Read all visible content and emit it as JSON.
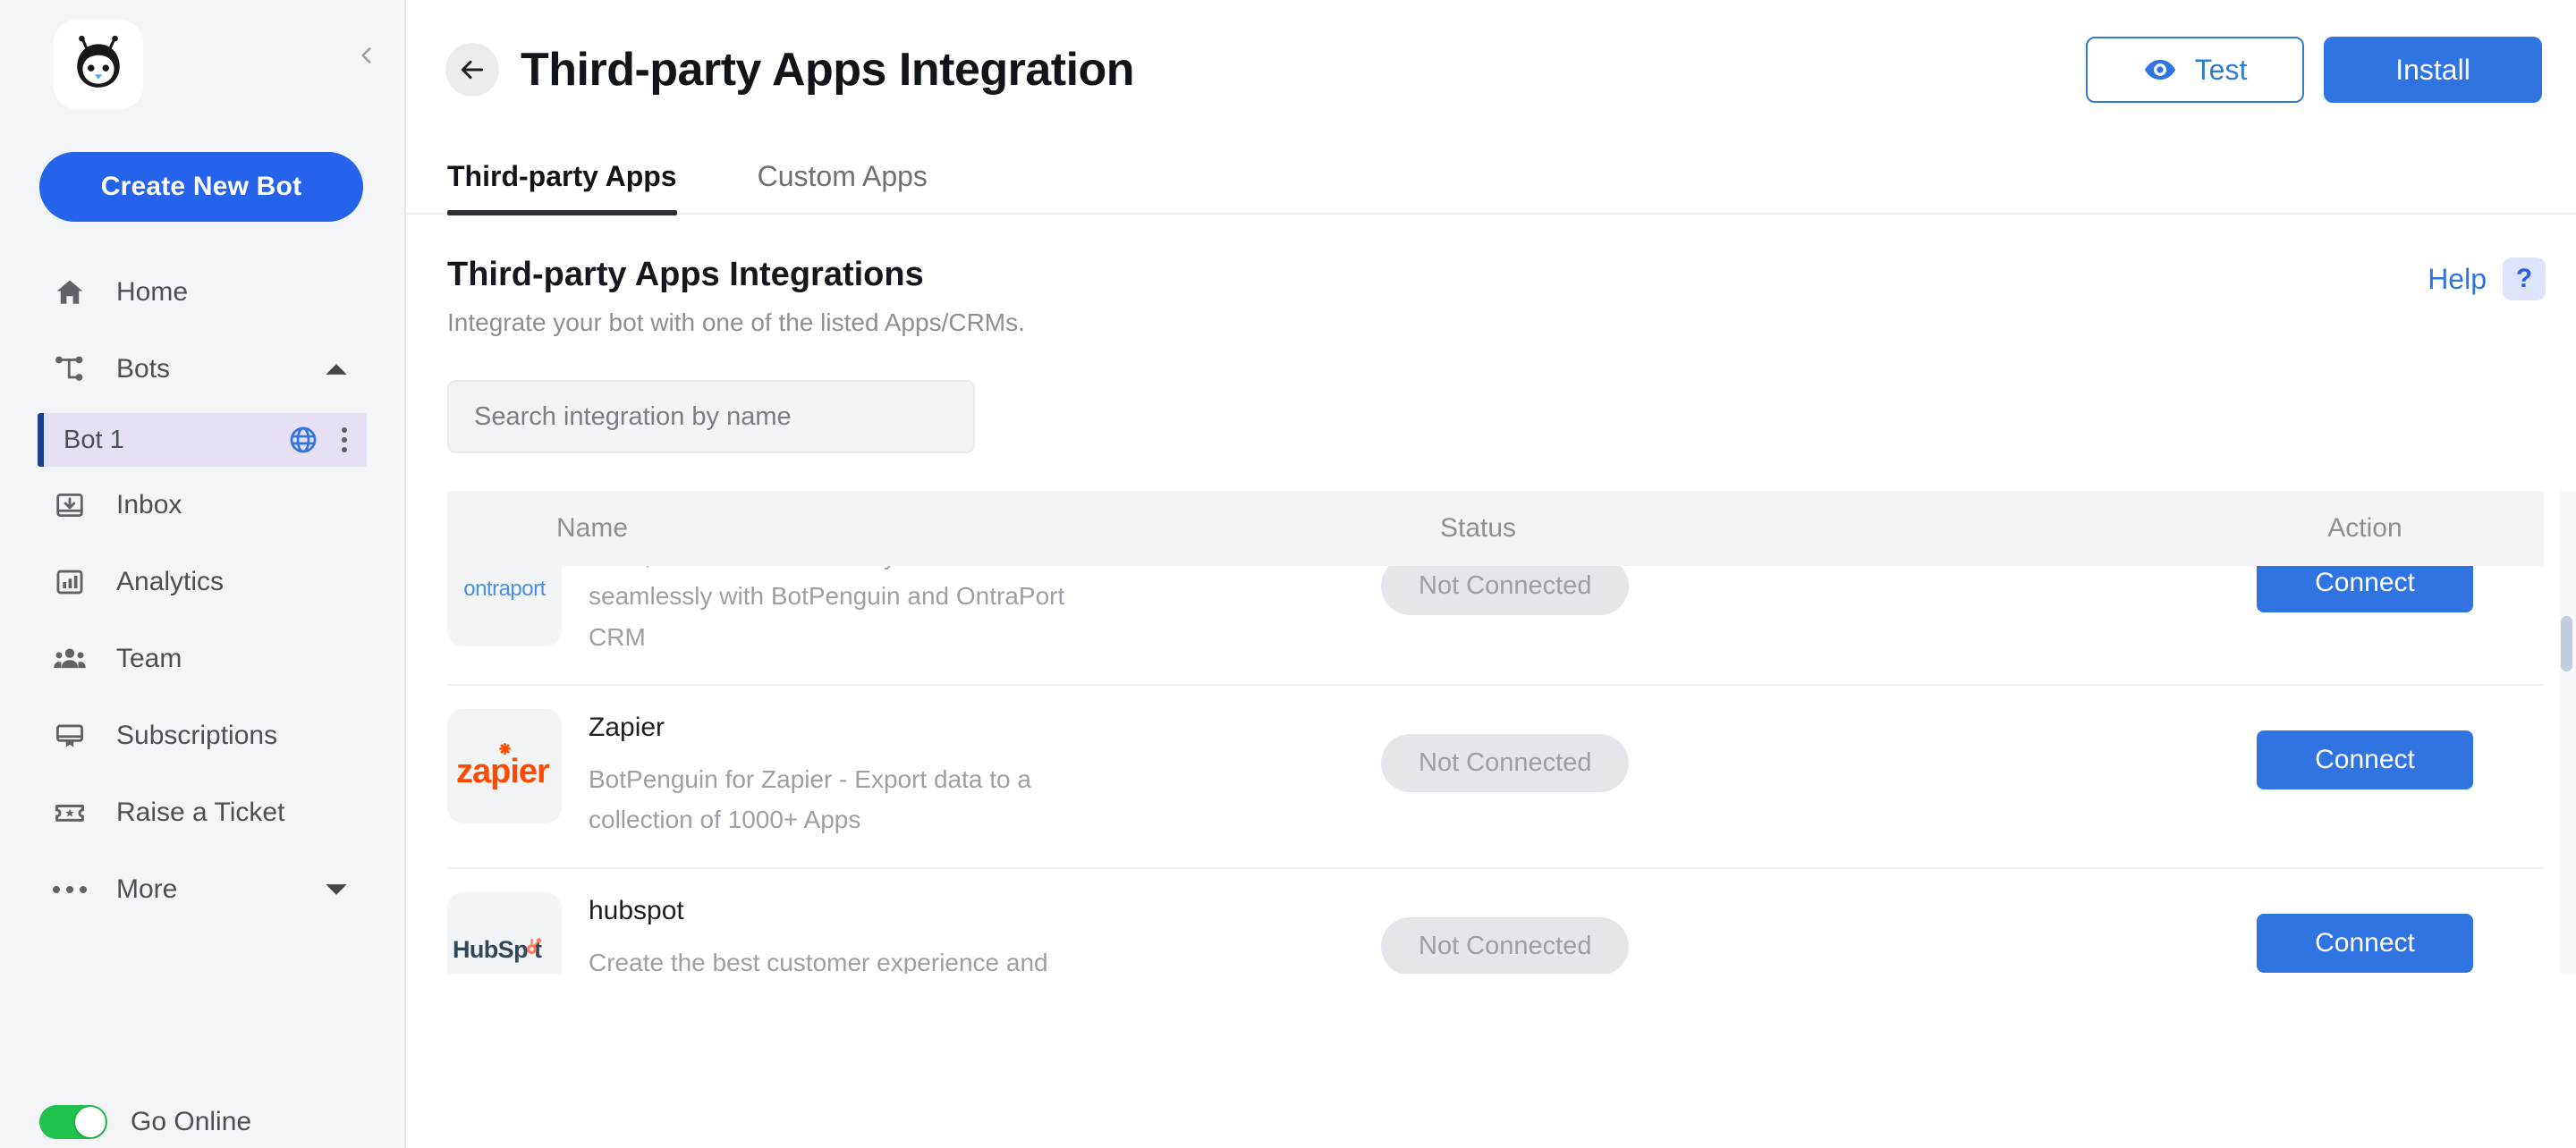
{
  "sidebar": {
    "logo_icon": "botpenguin-logo-icon",
    "collapse_icon": "chevron-left-icon",
    "create_bot_label": "Create New Bot",
    "items": [
      {
        "label": "Home",
        "icon": "home-icon",
        "caret": null
      },
      {
        "label": "Bots",
        "icon": "bots-hierarchy-icon",
        "caret": "chevron-up-icon"
      },
      {
        "label": "Inbox",
        "icon": "inbox-icon",
        "caret": null
      },
      {
        "label": "Analytics",
        "icon": "analytics-bar-chart-icon",
        "caret": null
      },
      {
        "label": "Team",
        "icon": "team-people-icon",
        "caret": null
      },
      {
        "label": "Subscriptions",
        "icon": "subscriptions-monitor-icon",
        "caret": null
      },
      {
        "label": "Raise a Ticket",
        "icon": "ticket-star-icon",
        "caret": null
      },
      {
        "label": "More",
        "icon": "more-dots-icon",
        "caret": "chevron-down-icon"
      }
    ],
    "bot": {
      "name": "Bot 1",
      "globe_icon": "globe-icon",
      "menu_icon": "kebab-menu-icon",
      "accent_color": "#1e3f8f",
      "background_color": "#e6e1f2"
    },
    "go_online": {
      "label": "Go Online",
      "enabled": true,
      "on_color": "#1fc24a"
    }
  },
  "header": {
    "back_icon": "arrow-left-icon",
    "title": "Third-party Apps Integration",
    "test_button": {
      "label": "Test",
      "icon": "eye-icon",
      "color": "#2f7bd4"
    },
    "install_button": {
      "label": "Install",
      "color": "#2f74e0"
    }
  },
  "tabs": [
    {
      "label": "Third-party Apps",
      "active": true
    },
    {
      "label": "Custom Apps",
      "active": false
    }
  ],
  "section": {
    "title": "Third-party Apps Integrations",
    "subtitle": "Integrate your bot with one of the listed Apps/CRMs.",
    "help_label": "Help",
    "help_badge": "?",
    "help_icon": "question-mark-icon"
  },
  "search": {
    "placeholder": "Search integration by name",
    "value": "",
    "icon": "search-input"
  },
  "table": {
    "columns": [
      "Name",
      "Status",
      "Action"
    ],
    "rows": [
      {
        "logo": "ontraport",
        "logo_text": "ontraport",
        "name": "",
        "description": "Build, automate and scale your business seamlessly with BotPenguin and OntraPort CRM",
        "status": "Not Connected",
        "action": "Connect",
        "clipped": true
      },
      {
        "logo": "zapier",
        "logo_text": "zapier",
        "name": "Zapier",
        "description": "BotPenguin for Zapier - Export data to a collection of 1000+ Apps",
        "status": "Not Connected",
        "action": "Connect",
        "clipped": false
      },
      {
        "logo": "hubspot",
        "logo_text": "HubSpot",
        "name": "hubspot",
        "description": "Create the best customer experience and content management with Hubspot and BotPenguin, ever!",
        "status": "Not Connected",
        "action": "Connect",
        "clipped": false
      }
    ]
  },
  "scrollbar": {
    "icon": "vertical-scrollbar",
    "thumb_position_pct": 22
  }
}
